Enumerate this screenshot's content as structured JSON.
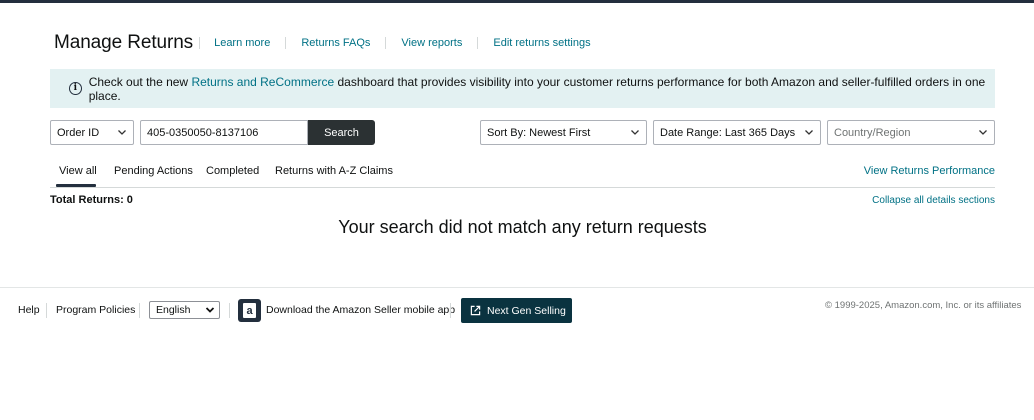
{
  "header": {
    "title": "Manage Returns",
    "links": [
      "Learn more",
      "Returns FAQs",
      "View reports",
      "Edit returns settings"
    ]
  },
  "banner": {
    "prefix": "Check out the new ",
    "link": "Returns and ReCommerce",
    "suffix": " dashboard that provides visibility into your customer returns performance for both Amazon and seller-fulfilled orders in one place."
  },
  "search": {
    "type_selected": "Order ID",
    "value": "405-0350050-8137106",
    "button": "Search",
    "sort": "Sort By: Newest First",
    "date_range": "Date Range: Last 365 Days",
    "country_placeholder": "Country/Region"
  },
  "tabs": {
    "items": [
      "View all",
      "Pending Actions",
      "Completed",
      "Returns with A-Z Claims"
    ],
    "active": "View all",
    "performance_link": "View Returns Performance"
  },
  "results": {
    "total_label": "Total Returns: 0",
    "collapse_link": "Collapse all details sections",
    "empty_message": "Your search did not match any return requests"
  },
  "footer": {
    "help": "Help",
    "policies": "Program Policies",
    "language": "English",
    "app_text": "Download the Amazon Seller mobile app",
    "next_gen": "Next Gen Selling",
    "copyright": "© 1999-2025, Amazon.com, Inc. or its affiliates"
  },
  "colors": {
    "link": "#007185",
    "banner_bg": "#e3f1f2",
    "search_button": "#2b3133",
    "next_gen_button": "#0a3340",
    "top_bar": "#232f3e"
  }
}
